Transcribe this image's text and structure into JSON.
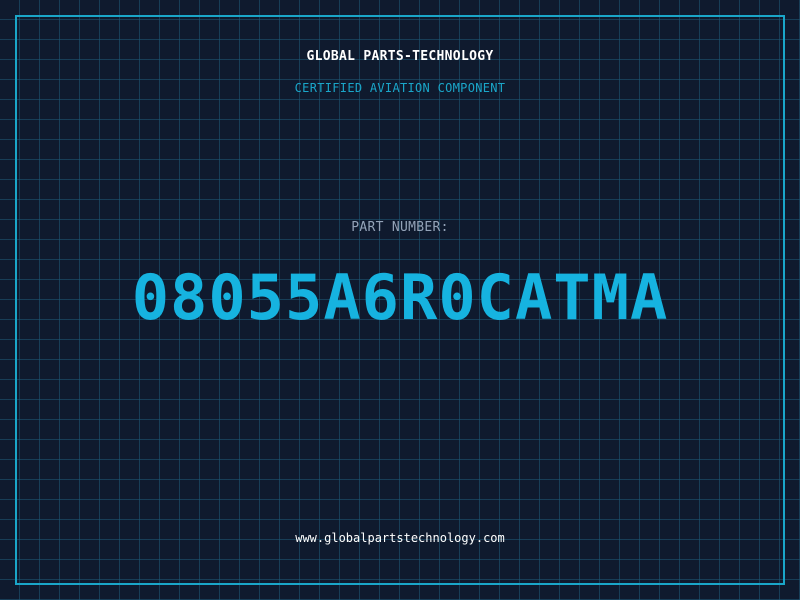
{
  "header": {
    "company_name": "GLOBAL PARTS-TECHNOLOGY",
    "subtitle": "CERTIFIED AVIATION COMPONENT"
  },
  "part": {
    "label": "PART NUMBER:",
    "number": "08055A6R0CATMA"
  },
  "footer": {
    "website": "www.globalpartstechnology.com"
  },
  "colors": {
    "background": "#0f1a2e",
    "accent": "#16b3e0",
    "frame": "#1aa6c9",
    "label": "#94a3b8",
    "text": "#ffffff"
  }
}
